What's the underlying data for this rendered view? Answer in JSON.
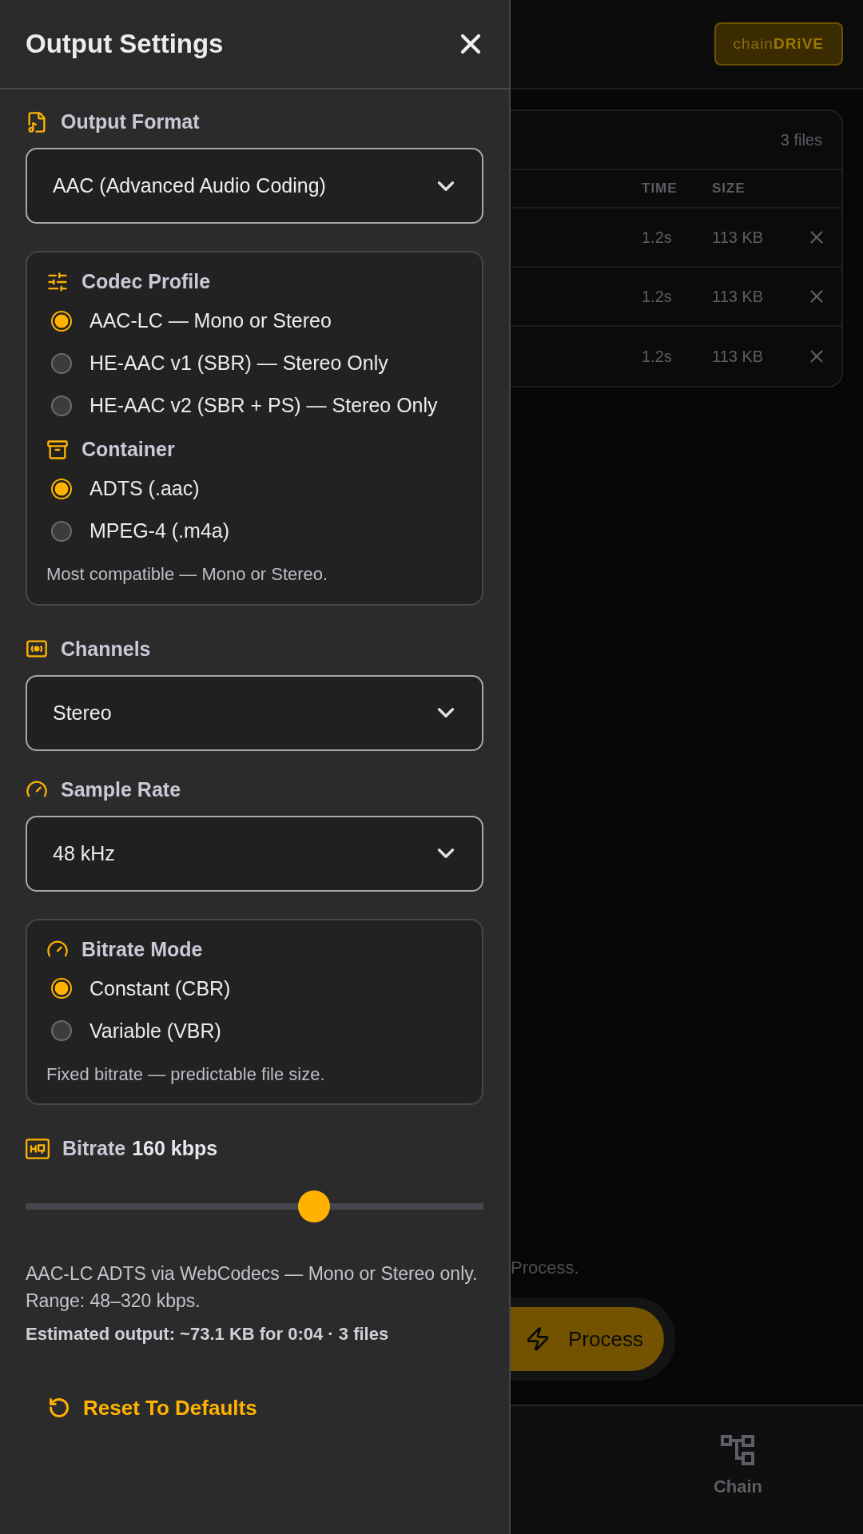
{
  "drawer": {
    "title": "Output Settings",
    "sections": [
      {
        "kind": "select",
        "label": "Output Format",
        "value": "AAC (Advanced Audio Coding)"
      },
      {
        "kind": "options",
        "groups": [
          {
            "label": "Codec Profile",
            "options": [
              {
                "label": "AAC-LC — Mono or Stereo",
                "selected": true
              },
              {
                "label": "HE-AAC v1 (SBR) — Stereo Only",
                "selected": false
              },
              {
                "label": "HE-AAC v2 (SBR + PS) — Stereo Only",
                "selected": false
              }
            ]
          },
          {
            "label": "Container",
            "options": [
              {
                "label": "ADTS (.aac)",
                "selected": true
              },
              {
                "label": "MPEG-4 (.m4a)",
                "selected": false
              }
            ]
          }
        ],
        "note": "Most compatible — Mono or Stereo."
      },
      {
        "kind": "select",
        "label": "Channels",
        "value": "Stereo"
      },
      {
        "kind": "select",
        "label": "Sample Rate",
        "value": "48 kHz"
      },
      {
        "kind": "options",
        "groups": [
          {
            "label": "Bitrate Mode",
            "options": [
              {
                "label": "Constant (CBR)",
                "selected": true
              },
              {
                "label": "Variable (VBR)",
                "selected": false
              }
            ]
          }
        ],
        "note": "Fixed bitrate — predictable file size."
      },
      {
        "kind": "slider",
        "label": "Bitrate",
        "value": "160 kbps",
        "level": 0.63,
        "note": "AAC-LC ADTS via WebCodecs — Mono or Stereo only. Range: 48–320 kbps.",
        "estimate": "Estimated output: ~73.1 KB for 0:04 · 3 files"
      }
    ],
    "reset": "Reset To Defaults"
  },
  "background": {
    "logo": "chain**DRiVE**",
    "files": {
      "count": "3 files",
      "columns": [
        "TIME",
        "SIZE"
      ],
      "rows": [
        {
          "time": "1.2s",
          "size": "113 KB"
        },
        {
          "time": "1.2s",
          "size": "113 KB"
        },
        {
          "time": "1.2s",
          "size": "113 KB"
        }
      ]
    },
    "hint": "Process.",
    "process_button": "Process",
    "nav": [
      {
        "label": "Chain"
      }
    ]
  }
}
